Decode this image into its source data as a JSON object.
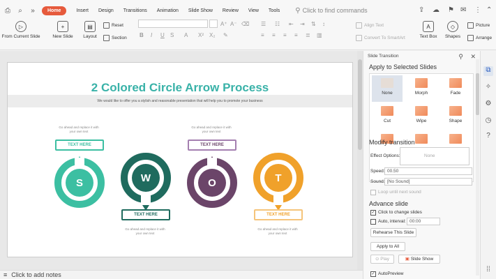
{
  "menu": {
    "home": "Home",
    "tabs": [
      "Insert",
      "Design",
      "Transitions",
      "Animation",
      "Slide Show",
      "Review",
      "View",
      "Tools"
    ],
    "search_placeholder": "Click to find commands"
  },
  "ribbon": {
    "from_current_slide": "From Current Slide",
    "new_slide": "New Slide",
    "layout": "Layout",
    "reset": "Reset",
    "section": "Section",
    "align_text": "Align Text",
    "convert_smartart": "Convert To SmartArt",
    "text_box": "Text Box",
    "shapes": "Shapes",
    "picture": "Picture",
    "arrange": "Arrange"
  },
  "slide": {
    "title": "2 Colored Circle Arrow Process",
    "subtitle": "We would like to offer you a stylish and reasonable presentation that will help you to promote your business",
    "desc_text": "Go ahead and replace it with your own text",
    "items": [
      {
        "letter": "S",
        "label": "TEXT HERE",
        "color": "#3cbfa2"
      },
      {
        "letter": "W",
        "label": "TEXT HERE",
        "color": "#1f6b5e"
      },
      {
        "letter": "O",
        "label": "TEXT HERE",
        "color": "#6b4569"
      },
      {
        "letter": "T",
        "label": "TEXT HERE",
        "color": "#f0a12a"
      }
    ]
  },
  "notes": {
    "placeholder": "Click to add notes"
  },
  "pane": {
    "header": "Slide Transition",
    "apply_section": "Apply to Selected Slides",
    "transitions": [
      "None",
      "Morph",
      "Fade",
      "Cut",
      "Wipe",
      "Shape",
      "",
      "",
      ""
    ],
    "modify_section": "Modify transition",
    "effect_options_label": "Effect Options:",
    "effect_options_value": "None",
    "speed_label": "Speed:",
    "speed_value": "00.50",
    "sound_label": "Sound:",
    "sound_value": "[No Sound]",
    "loop_label": "Loop until next sound",
    "advance_section": "Advance slide",
    "click_label": "Click to change slides",
    "auto_label": "Auto, interval:",
    "auto_value": "00:00",
    "rehearse": "Rehearse This Slide",
    "apply_all": "Apply to All",
    "play": "Play",
    "slide_show": "Slide Show",
    "autopreview": "AutoPreview"
  },
  "colors": {
    "accent": "#e65a3c",
    "title": "#39b2a8"
  }
}
